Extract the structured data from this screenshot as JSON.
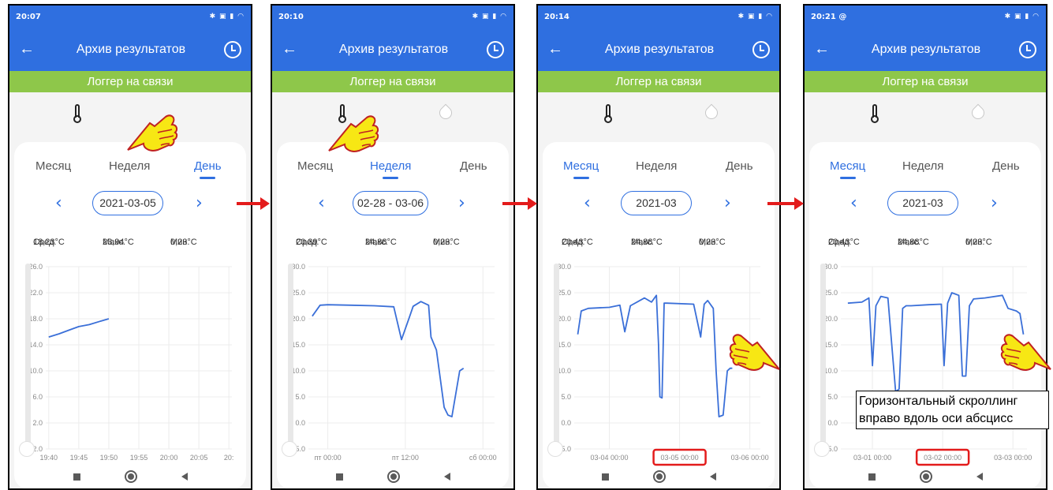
{
  "screens": [
    {
      "status_time": "20:07",
      "title": "Архив результатов",
      "online_banner": "Логгер на связи",
      "tabs": [
        "Месяц",
        "Неделя",
        "День"
      ],
      "active_tab": "День",
      "date_label": "2021-03-05",
      "stats": {
        "avg_label": "Сред.",
        "avg_value": "18,23°C",
        "max_label": "Макс.",
        "max_value": "23,94°C",
        "min_label": "Мин.",
        "min_value": "0,23°C"
      },
      "humidity_sensor_visible": false,
      "chart": {
        "type": "line",
        "y_ticks": [
          "26.0",
          "22.0",
          "18.0",
          "14.0",
          "10.0",
          "6.0",
          "2.0",
          "-2.0"
        ],
        "ylim": [
          -2,
          26
        ],
        "x_ticks": [
          "19:40",
          "19:45",
          "19:50",
          "19:55",
          "20:00",
          "20:05",
          "20:"
        ],
        "series": [
          {
            "x": [
              0,
              0.35,
              0.7,
              1.0,
              1.35,
              1.7,
              2.0
            ],
            "y": [
              15.2,
              15.7,
              16.3,
              16.8,
              17.1,
              17.6,
              18.0
            ]
          }
        ],
        "xlim": [
          -0.1,
          6.1
        ],
        "grid": true
      }
    },
    {
      "status_time": "20:10",
      "title": "Архив результатов",
      "online_banner": "Логгер на связи",
      "tabs": [
        "Месяц",
        "Неделя",
        "День"
      ],
      "active_tab": "Неделя",
      "date_label": "02-28 - 03-06",
      "stats": {
        "avg_label": "Сред.",
        "avg_value": "20,39°C",
        "max_label": "Макс.",
        "max_value": "24,88°C",
        "min_label": "Мин.",
        "min_value": "0,23°C"
      },
      "humidity_sensor_visible": true,
      "chart": {
        "type": "line",
        "y_ticks": [
          "30.0",
          "25.0",
          "20.0",
          "15.0",
          "10.0",
          "5.0",
          "0.0",
          "-5.0"
        ],
        "ylim": [
          -5,
          30
        ],
        "x_ticks": [
          "пт 00:00",
          "пт 12:00",
          "сб 00:00"
        ],
        "series": [
          {
            "x": [
              -0.2,
              -0.1,
              0.0,
              0.3,
              0.6,
              0.85,
              0.95,
              1.05,
              1.1,
              1.2,
              1.3,
              1.33,
              1.4,
              1.5,
              1.55,
              1.6,
              1.7,
              1.75
            ],
            "y": [
              20.5,
              22.6,
              22.7,
              22.6,
              22.5,
              22.3,
              16.0,
              20.2,
              22.4,
              23.3,
              22.6,
              16.5,
              14.0,
              3.0,
              1.5,
              1.2,
              10.0,
              10.5
            ]
          }
        ],
        "xlim": [
          -0.25,
          2.15
        ],
        "grid": true
      }
    },
    {
      "status_time": "20:14",
      "title": "Архив результатов",
      "online_banner": "Логгер на связи",
      "tabs": [
        "Месяц",
        "Неделя",
        "День"
      ],
      "active_tab": "Месяц",
      "date_label": "2021-03",
      "stats": {
        "avg_label": "Сред.",
        "avg_value": "20,43°C",
        "max_label": "Макс.",
        "max_value": "24,88°C",
        "min_label": "Мин.",
        "min_value": "0,23°C"
      },
      "humidity_sensor_visible": true,
      "chart": {
        "type": "line",
        "y_ticks": [
          "30.0",
          "25.0",
          "20.0",
          "15.0",
          "10.0",
          "5.0",
          "0.0",
          "-5.0"
        ],
        "ylim": [
          -5,
          30
        ],
        "x_ticks": [
          "03-04 00:00",
          "03-05 00:00",
          "03-06 00:00"
        ],
        "highlight_x_tick": "03-05 00:00",
        "series": [
          {
            "x": [
              -0.45,
              -0.4,
              -0.3,
              0.0,
              0.15,
              0.22,
              0.3,
              0.5,
              0.6,
              0.67,
              0.7,
              0.72,
              0.75,
              0.78,
              0.82,
              1.2,
              1.3,
              1.35,
              1.4,
              1.48,
              1.52,
              1.56,
              1.62,
              1.68,
              1.72,
              1.75
            ],
            "y": [
              17.0,
              21.5,
              22.0,
              22.2,
              22.6,
              17.5,
              22.5,
              24.0,
              23.2,
              24.5,
              15.0,
              5.0,
              4.8,
              23.0,
              23.0,
              22.8,
              16.5,
              22.8,
              23.5,
              22.0,
              10.0,
              1.2,
              1.5,
              10.0,
              10.5,
              10.5
            ]
          }
        ],
        "xlim": [
          -0.5,
          2.15
        ],
        "grid": true
      }
    },
    {
      "status_time": "20:21 @",
      "title": "Архив результатов",
      "online_banner": "Логгер на связи",
      "tabs": [
        "Месяц",
        "Неделя",
        "День"
      ],
      "active_tab": "Месяц",
      "date_label": "2021-03",
      "stats": {
        "avg_label": "Сред.",
        "avg_value": "20,43°C",
        "max_label": "Макс.",
        "max_value": "24,88°C",
        "min_label": "Мин.",
        "min_value": "0,23°C"
      },
      "humidity_sensor_visible": true,
      "chart": {
        "type": "line",
        "y_ticks": [
          "30.0",
          "25.0",
          "20.0",
          "15.0",
          "10.0",
          "5.0",
          "0.0",
          "-5.0"
        ],
        "ylim": [
          -5,
          30
        ],
        "x_ticks": [
          "03-01 00:00",
          "03-02 00:00",
          "03-03 00:00"
        ],
        "highlight_x_tick": "03-02 00:00",
        "series": [
          {
            "x": [
              -0.35,
              -0.15,
              -0.05,
              0.0,
              0.05,
              0.12,
              0.22,
              0.33,
              0.38,
              0.43,
              0.48,
              0.55,
              0.8,
              0.98,
              1.02,
              1.07,
              1.13,
              1.23,
              1.28,
              1.33,
              1.38,
              1.44,
              1.6,
              1.85,
              1.93,
              2.05,
              2.1,
              2.15
            ],
            "y": [
              23.0,
              23.2,
              24.0,
              11.0,
              22.5,
              24.3,
              24.0,
              6.0,
              6.5,
              22.0,
              22.5,
              22.5,
              22.7,
              22.8,
              11.0,
              23.0,
              25.0,
              24.5,
              9.0,
              9.0,
              22.5,
              23.8,
              24.0,
              24.5,
              22.0,
              21.5,
              21.0,
              17.0
            ]
          }
        ],
        "xlim": [
          -0.45,
          2.2
        ],
        "grid": true
      }
    }
  ],
  "annotation_text": "Горизонтальный скроллинг вправо вдоль оси абсцисс",
  "colors": {
    "appbar": "#2f6fe0",
    "online": "#8ec74a",
    "line": "#3a6fd8",
    "arrow": "#e31b1b",
    "hand": "#f7e714"
  }
}
